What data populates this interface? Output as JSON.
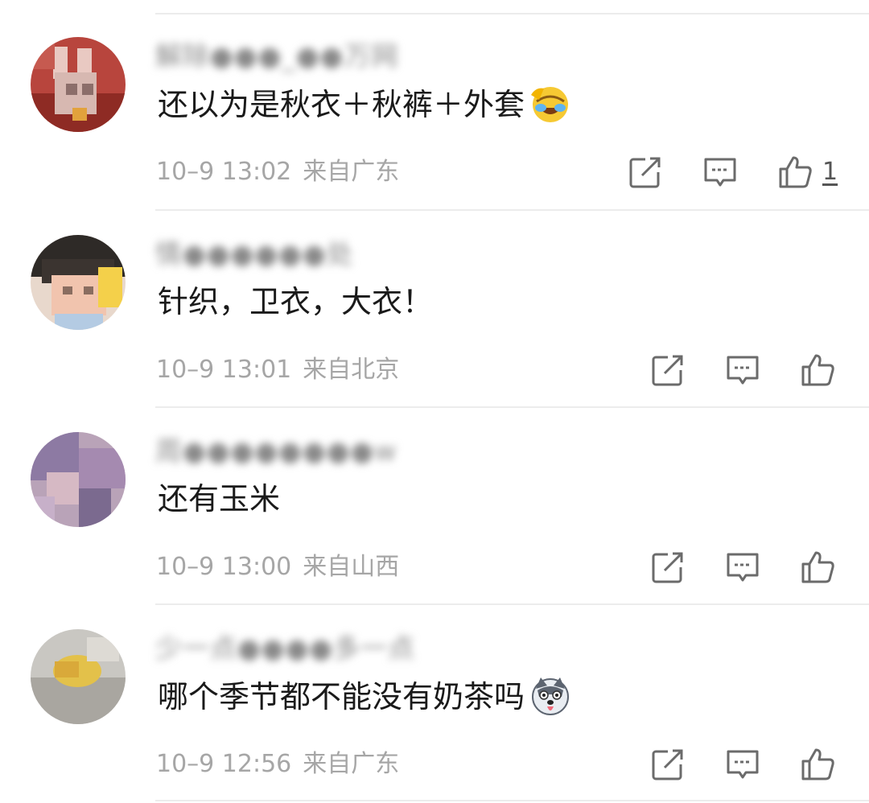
{
  "comments": [
    {
      "username": "解除●●●_●●万网",
      "text": "还以为是秋衣＋秋裤＋外套",
      "emoji": "laugh-cry-emoji",
      "time": "10–9 13:02",
      "location": "来自广东",
      "likes": "1"
    },
    {
      "username": "情●●●●●●处",
      "text": "针织，卫衣，大衣！",
      "emoji": "",
      "time": "10–9 13:01",
      "location": "来自北京",
      "likes": ""
    },
    {
      "username": "周●●●●●●●●w",
      "text": "还有玉米",
      "emoji": "",
      "time": "10–9 13:00",
      "location": "来自山西",
      "likes": ""
    },
    {
      "username": "少一点●●●●多一点",
      "text": "哪个季节都不能没有奶茶吗",
      "emoji": "husky-emoji",
      "time": "10–9 12:56",
      "location": "来自广东",
      "likes": ""
    }
  ],
  "colors": {
    "text": "#1a1a1a",
    "meta": "#a6a6a6",
    "icon": "#6b6b6b",
    "separator": "#ececec"
  }
}
